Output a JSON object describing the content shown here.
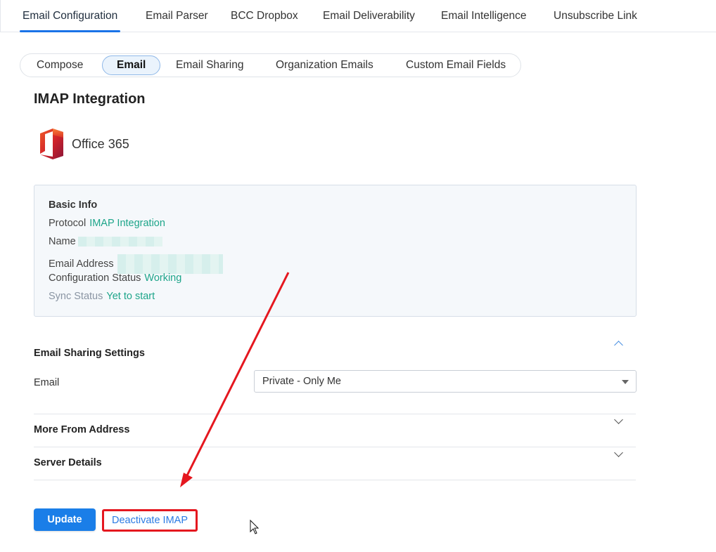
{
  "top_tabs": [
    {
      "label": "Email Configuration",
      "active": true
    },
    {
      "label": "Email Parser",
      "active": false
    },
    {
      "label": "BCC Dropbox",
      "active": false
    },
    {
      "label": "Email Deliverability",
      "active": false
    },
    {
      "label": "Email Intelligence",
      "active": false
    },
    {
      "label": "Unsubscribe Link",
      "active": false
    }
  ],
  "sub_tabs": [
    {
      "label": "Compose",
      "active": false
    },
    {
      "label": "Email",
      "active": true
    },
    {
      "label": "Email Sharing",
      "active": false
    },
    {
      "label": "Organization Emails",
      "active": false
    },
    {
      "label": "Custom Email Fields",
      "active": false
    }
  ],
  "section_title": "IMAP Integration",
  "provider": {
    "name": "Office 365",
    "icon": "office365-logo"
  },
  "basic_info": {
    "heading": "Basic Info",
    "protocol": {
      "label": "Protocol",
      "value": "IMAP Integration"
    },
    "name": {
      "label": "Name",
      "value": ""
    },
    "email_address": {
      "label": "Email Address",
      "value": ""
    },
    "configuration_status": {
      "label": "Configuration Status",
      "value": "Working"
    },
    "sync_status": {
      "label": "Sync Status",
      "value": "Yet to start"
    }
  },
  "email_sharing": {
    "title": "Email Sharing Settings",
    "email_label": "Email",
    "email_select_value": "Private - Only Me",
    "expanded": true
  },
  "accordions": [
    {
      "title": "More From Address",
      "expanded": false
    },
    {
      "title": "Server Details",
      "expanded": false
    }
  ],
  "actions": {
    "update_label": "Update",
    "deactivate_label": "Deactivate IMAP"
  },
  "colors": {
    "accent": "#1a7ee8",
    "status_green": "#1ea58a",
    "annotation_red": "#e5171f"
  }
}
